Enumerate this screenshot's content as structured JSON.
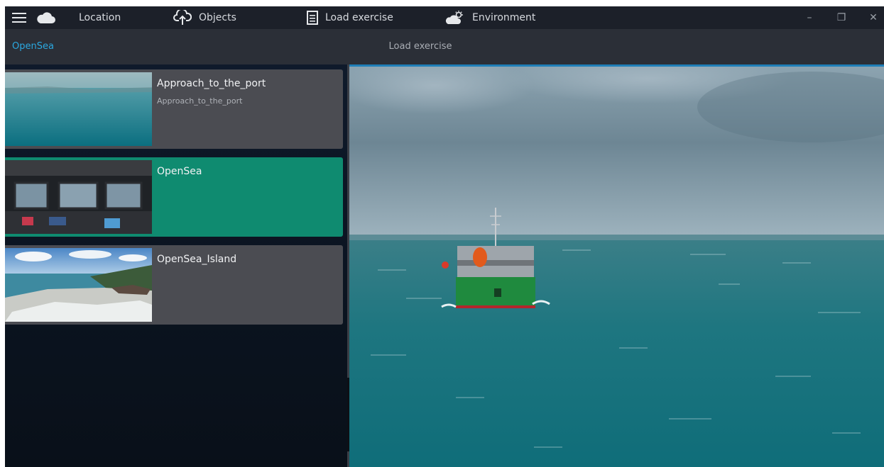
{
  "topbar": {
    "icons": {
      "menu": "hamburger-icon",
      "cloud": "cloud-icon",
      "objects": "cloud-upload-icon",
      "load": "document-icon",
      "environment": "weather-icon"
    },
    "items": [
      {
        "label": "Location"
      },
      {
        "label": "Objects"
      },
      {
        "label": "Load exercise"
      },
      {
        "label": "Environment"
      }
    ],
    "window_controls": {
      "minimize": "–",
      "maximize": "❐",
      "close": "✕"
    }
  },
  "subbar": {
    "breadcrumb": "OpenSea",
    "title": "Load exercise"
  },
  "exercises": [
    {
      "title": "Approach_to_the_port",
      "subtitle": "Approach_to_the_port",
      "selected": false
    },
    {
      "title": "OpenSea",
      "subtitle": "",
      "selected": true
    },
    {
      "title": "OpenSea_Island",
      "subtitle": "",
      "selected": false
    }
  ],
  "panel": {
    "collapse_icon": "chevron-left-icon"
  },
  "colors": {
    "accent_selected": "#0f8b70",
    "breadcrumb": "#2ba8e0",
    "topbar": "#1c2029",
    "subbar": "#2b2f37"
  }
}
